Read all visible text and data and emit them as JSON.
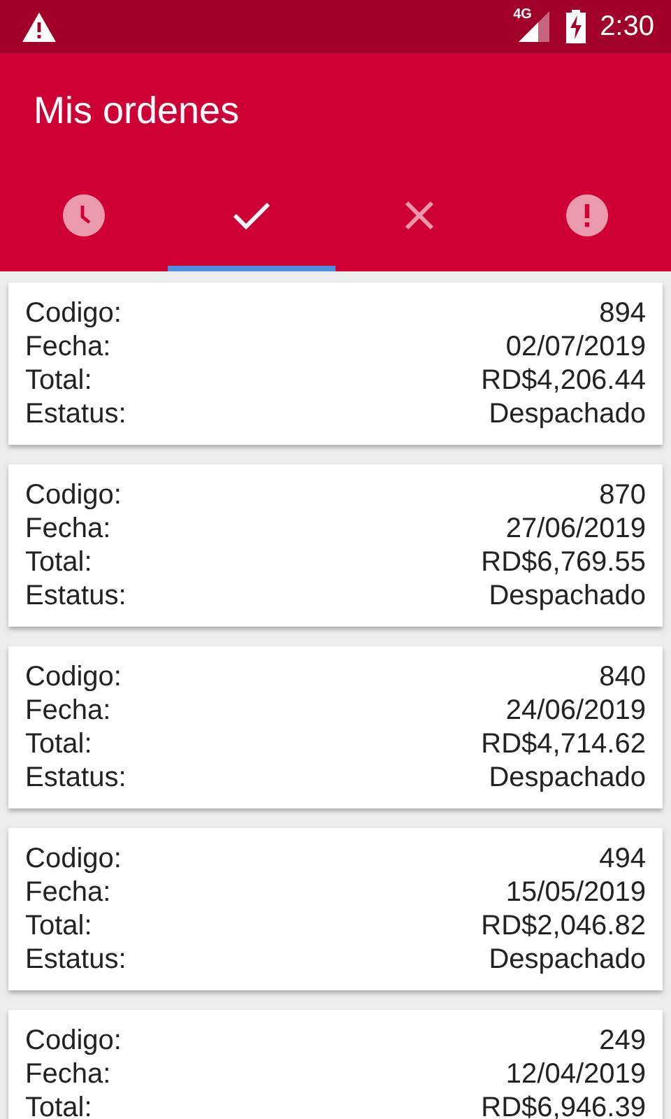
{
  "status_bar": {
    "network": "4G",
    "time": "2:30"
  },
  "app_bar": {
    "title": "Mis ordenes"
  },
  "tabs": [
    {
      "kind": "clock",
      "selected": false
    },
    {
      "kind": "check",
      "selected": true
    },
    {
      "kind": "close",
      "selected": false
    },
    {
      "kind": "alert",
      "selected": false
    }
  ],
  "orders": [
    {
      "rows": [
        {
          "label": "Codigo:",
          "value": "894"
        },
        {
          "label": "Fecha:",
          "value": "02/07/2019"
        },
        {
          "label": "Total:",
          "value": "RD$4,206.44"
        },
        {
          "label": "Estatus:",
          "value": "Despachado"
        }
      ]
    },
    {
      "rows": [
        {
          "label": "Codigo:",
          "value": "870"
        },
        {
          "label": "Fecha:",
          "value": "27/06/2019"
        },
        {
          "label": "Total:",
          "value": "RD$6,769.55"
        },
        {
          "label": "Estatus:",
          "value": "Despachado"
        }
      ]
    },
    {
      "rows": [
        {
          "label": "Codigo:",
          "value": "840"
        },
        {
          "label": "Fecha:",
          "value": "24/06/2019"
        },
        {
          "label": "Total:",
          "value": "RD$4,714.62"
        },
        {
          "label": "Estatus:",
          "value": "Despachado"
        }
      ]
    },
    {
      "rows": [
        {
          "label": "Codigo:",
          "value": "494"
        },
        {
          "label": "Fecha:",
          "value": "15/05/2019"
        },
        {
          "label": "Total:",
          "value": "RD$2,046.82"
        },
        {
          "label": "Estatus:",
          "value": "Despachado"
        }
      ]
    },
    {
      "rows": [
        {
          "label": "Codigo:",
          "value": "249"
        },
        {
          "label": "Fecha:",
          "value": "12/04/2019"
        },
        {
          "label": "Total:",
          "value": "RD$6,946.39"
        }
      ]
    }
  ]
}
